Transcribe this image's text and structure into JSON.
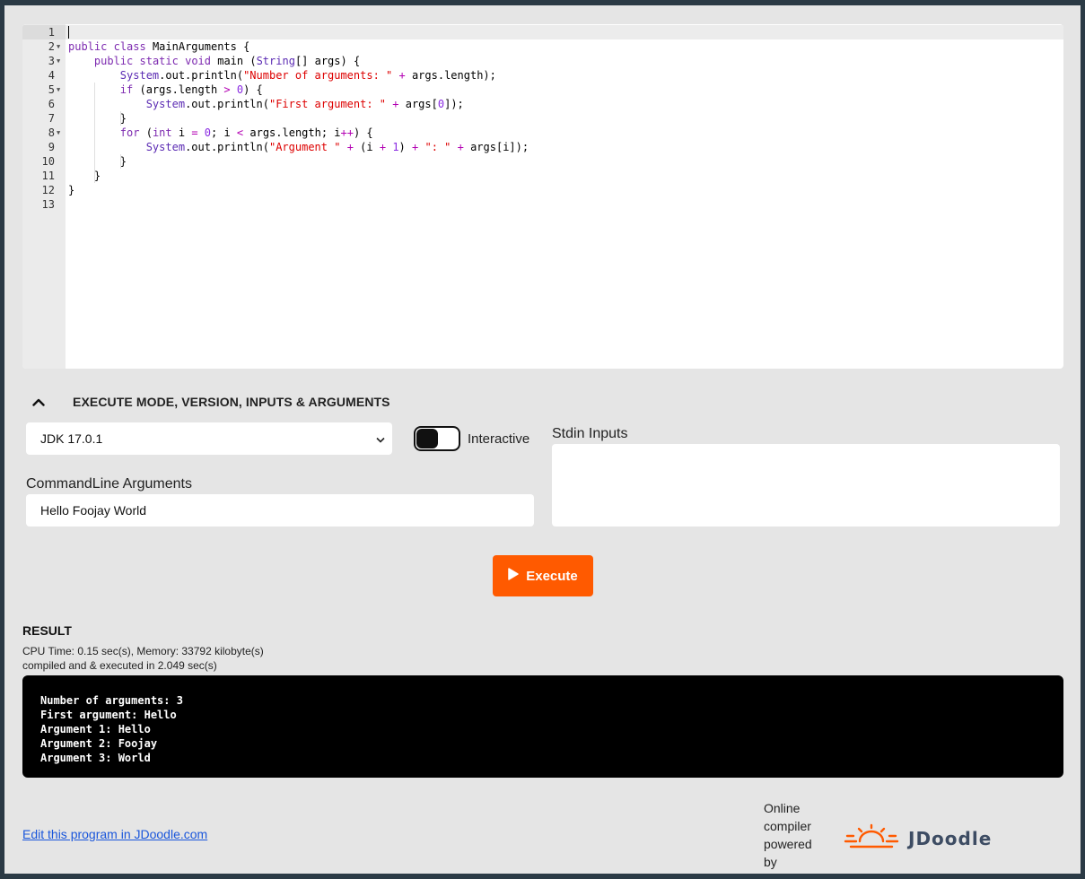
{
  "editor": {
    "line_numbers": [
      "1",
      "2",
      "3",
      "4",
      "5",
      "6",
      "7",
      "8",
      "9",
      "10",
      "11",
      "12",
      "13"
    ],
    "folds": [
      "2",
      "3",
      "5",
      "8"
    ],
    "code_lines": [
      "",
      "public class MainArguments {",
      "    public static void main (String[] args) {",
      "        System.out.println(\"Number of arguments: \" + args.length);",
      "        if (args.length > 0) {",
      "            System.out.println(\"First argument: \" + args[0]);",
      "        }",
      "        for (int i = 0; i < args.length; i++) {",
      "            System.out.println(\"Argument \" + (i + 1) + \": \" + args[i]);",
      "        }",
      "    }",
      "}",
      ""
    ]
  },
  "execute_section": {
    "title": "EXECUTE MODE, VERSION, INPUTS & ARGUMENTS",
    "version_selected": "JDK 17.0.1",
    "interactive_label": "Interactive",
    "stdin_label": "Stdin Inputs",
    "stdin_value": "",
    "args_label": "CommandLine Arguments",
    "args_value": "Hello Foojay World",
    "execute_label": "Execute"
  },
  "result": {
    "title": "RESULT",
    "stats_line1": "CPU Time: 0.15 sec(s), Memory: 33792 kilobyte(s)",
    "stats_line2": "compiled and & executed in 2.049 sec(s)",
    "output_lines": [
      "Number of arguments: 3",
      "First argument: Hello",
      "Argument 1: Hello",
      "Argument 2: Foojay",
      "Argument 3: World"
    ]
  },
  "footer": {
    "edit_link": "Edit this program in JDoodle.com",
    "powered_by": "Online compiler powered by",
    "logo_text": "JDoodle"
  },
  "colors": {
    "accent": "#ff5a00",
    "link": "#1a56db",
    "background": "#e5e5e5"
  }
}
